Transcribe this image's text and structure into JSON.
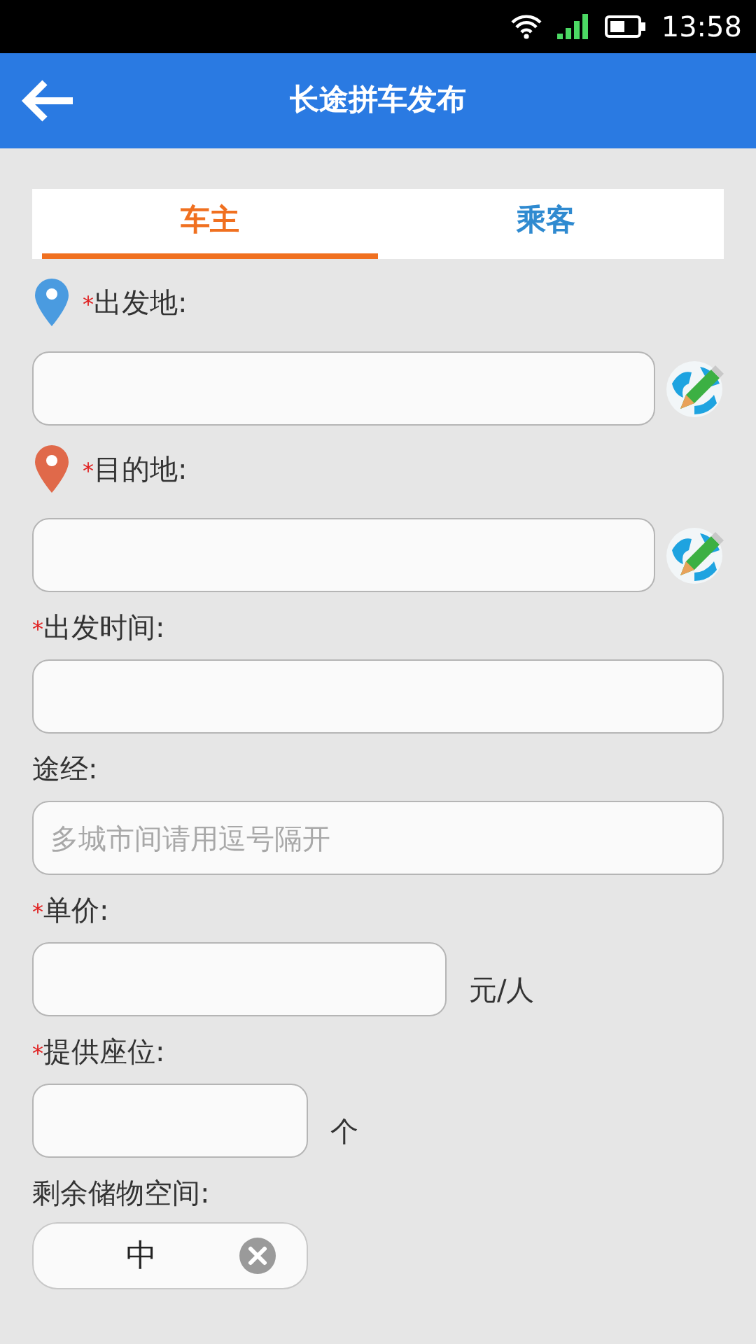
{
  "status_bar": {
    "time": "13:58"
  },
  "header": {
    "title": "长途拼车发布"
  },
  "tabs": [
    {
      "label": "车主",
      "selected": true
    },
    {
      "label": "乘客",
      "selected": false
    }
  ],
  "fields": [
    {
      "kind": "location",
      "mark": "*",
      "label": "出发地:",
      "color": "#4a9be0"
    },
    {
      "kind": "location",
      "mark": "*",
      "label": "目的地:",
      "color": "#e0694a"
    },
    {
      "kind": "text",
      "mark": "*",
      "label": "出发时间:"
    },
    {
      "kind": "text",
      "label": "途经:",
      "placeholder": "多城市间请用逗号隔开"
    },
    {
      "kind": "price",
      "mark": "*",
      "label": "单价:",
      "unit": "元/人"
    },
    {
      "kind": "count",
      "mark": "*",
      "label": "提供座位:",
      "unit": "个"
    },
    {
      "kind": "select",
      "label": "剩余储物空间:",
      "value": "中"
    }
  ]
}
